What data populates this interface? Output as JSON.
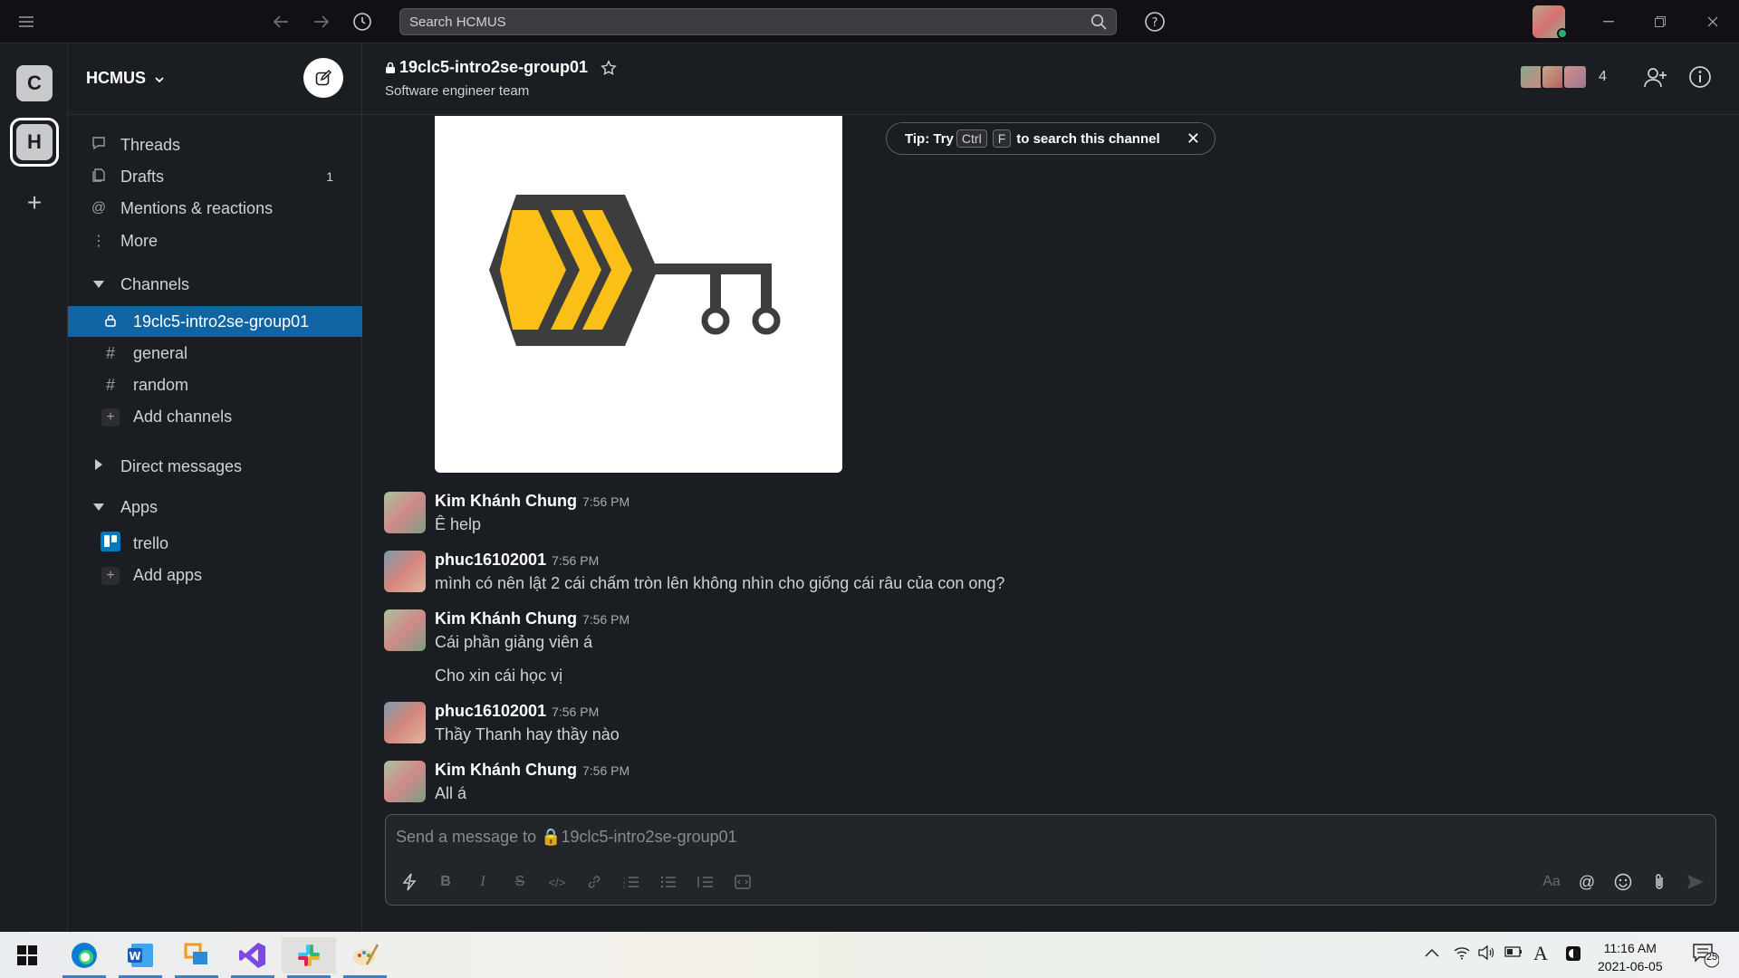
{
  "topbar": {
    "search_placeholder": "Search HCMUS",
    "icons": [
      "hamburger-icon",
      "back-icon",
      "forward-icon",
      "history-icon",
      "search-icon",
      "help-icon"
    ]
  },
  "rail": {
    "workspaces": [
      {
        "letter": "C",
        "active": false
      },
      {
        "letter": "H",
        "active": true
      }
    ],
    "add_label": "+"
  },
  "sidebar": {
    "workspace_name": "HCMUS",
    "nav": [
      {
        "label": "Threads",
        "icon": "threads-icon"
      },
      {
        "label": "Drafts",
        "icon": "drafts-icon",
        "badge": "1"
      },
      {
        "label": "Mentions & reactions",
        "icon": "at-icon"
      },
      {
        "label": "More",
        "icon": "more-icon"
      }
    ],
    "channels_header": "Channels",
    "channels": [
      {
        "label": "19clc5-intro2se-group01",
        "prefix": "🔒",
        "active": true
      },
      {
        "label": "general",
        "prefix": "#"
      },
      {
        "label": "random",
        "prefix": "#"
      }
    ],
    "add_channels": "Add channels",
    "dm_header": "Direct messages",
    "apps_header": "Apps",
    "apps": [
      {
        "label": "trello"
      }
    ],
    "add_apps": "Add apps"
  },
  "channel": {
    "name": "19clc5-intro2se-group01",
    "topic": "Software engineer team",
    "member_count": "4"
  },
  "tip": {
    "prefix": "Tip: Try",
    "key1": "Ctrl",
    "key2": "F",
    "suffix": "to search this channel"
  },
  "messages": [
    {
      "author": "Kim Khánh Chung",
      "time": "7:56 PM",
      "lines": [
        "Ê help"
      ]
    },
    {
      "author": "phuc16102001",
      "time": "7:56 PM",
      "lines": [
        "mình có nên lật 2 cái chấm tròn lên không nhìn cho giống cái râu của con ong?"
      ]
    },
    {
      "author": "Kim Khánh Chung",
      "time": "7:56 PM",
      "lines": [
        "Cái phần giảng viên á",
        "Cho xin cái học vị"
      ]
    },
    {
      "author": "phuc16102001",
      "time": "7:56 PM",
      "lines": [
        "Thầy Thanh hay thầy nào"
      ]
    },
    {
      "author": "Kim Khánh Chung",
      "time": "7:56 PM",
      "lines": [
        "All á"
      ]
    }
  ],
  "composer": {
    "placeholder": "Send a message to 🔒19clc5-intro2se-group01",
    "format_label": "Aa"
  },
  "taskbar": {
    "time": "11:16 AM",
    "date": "2021-06-05",
    "notification_count": "25",
    "ime": "A"
  },
  "colors": {
    "accent": "#1164a3",
    "background": "#1a1d21",
    "logo_yellow": "#fbbf17",
    "logo_dark": "#3d3d3d"
  }
}
